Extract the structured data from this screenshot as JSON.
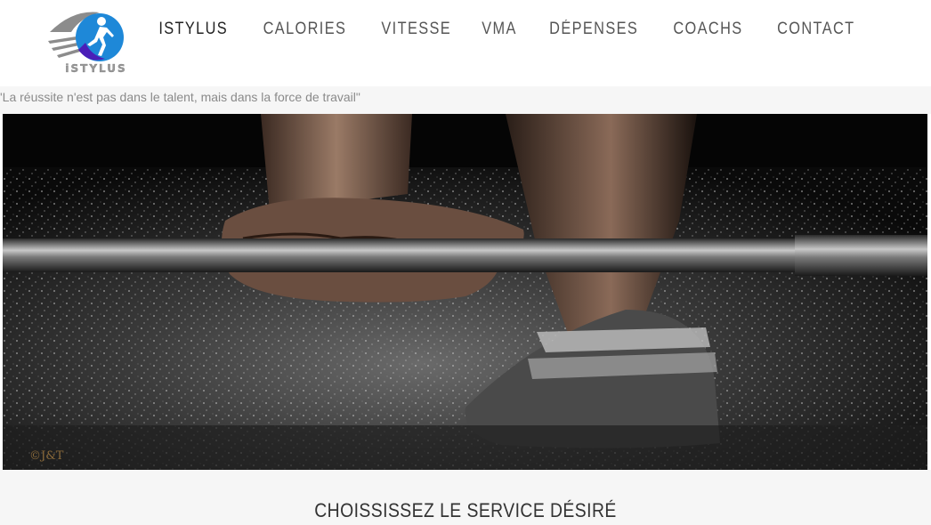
{
  "brand": {
    "logo_text": "iSTYLUS",
    "colors": {
      "logo_blue": "#1e88d8",
      "logo_purple": "#4a1fb8",
      "logo_gray": "#8c8c8c"
    }
  },
  "nav": {
    "items": [
      {
        "label": "ISTYLUS",
        "active": true
      },
      {
        "label": "CALORIES",
        "active": false
      },
      {
        "label": "VITESSE",
        "active": false
      },
      {
        "label": "VMA",
        "active": false
      },
      {
        "label": "DÉPENSES",
        "active": false
      },
      {
        "label": "COACHS",
        "active": false
      },
      {
        "label": "CONTACT",
        "active": false
      }
    ]
  },
  "tagline": "'La réussite n'est pas dans le talent, mais dans la force de travail\"",
  "hero": {
    "image_icon": "weightlifting-photo",
    "watermark": "©J&T"
  },
  "services": {
    "title": "CHOISSISSEZ LE SERVICE DÉSIRÉ"
  }
}
